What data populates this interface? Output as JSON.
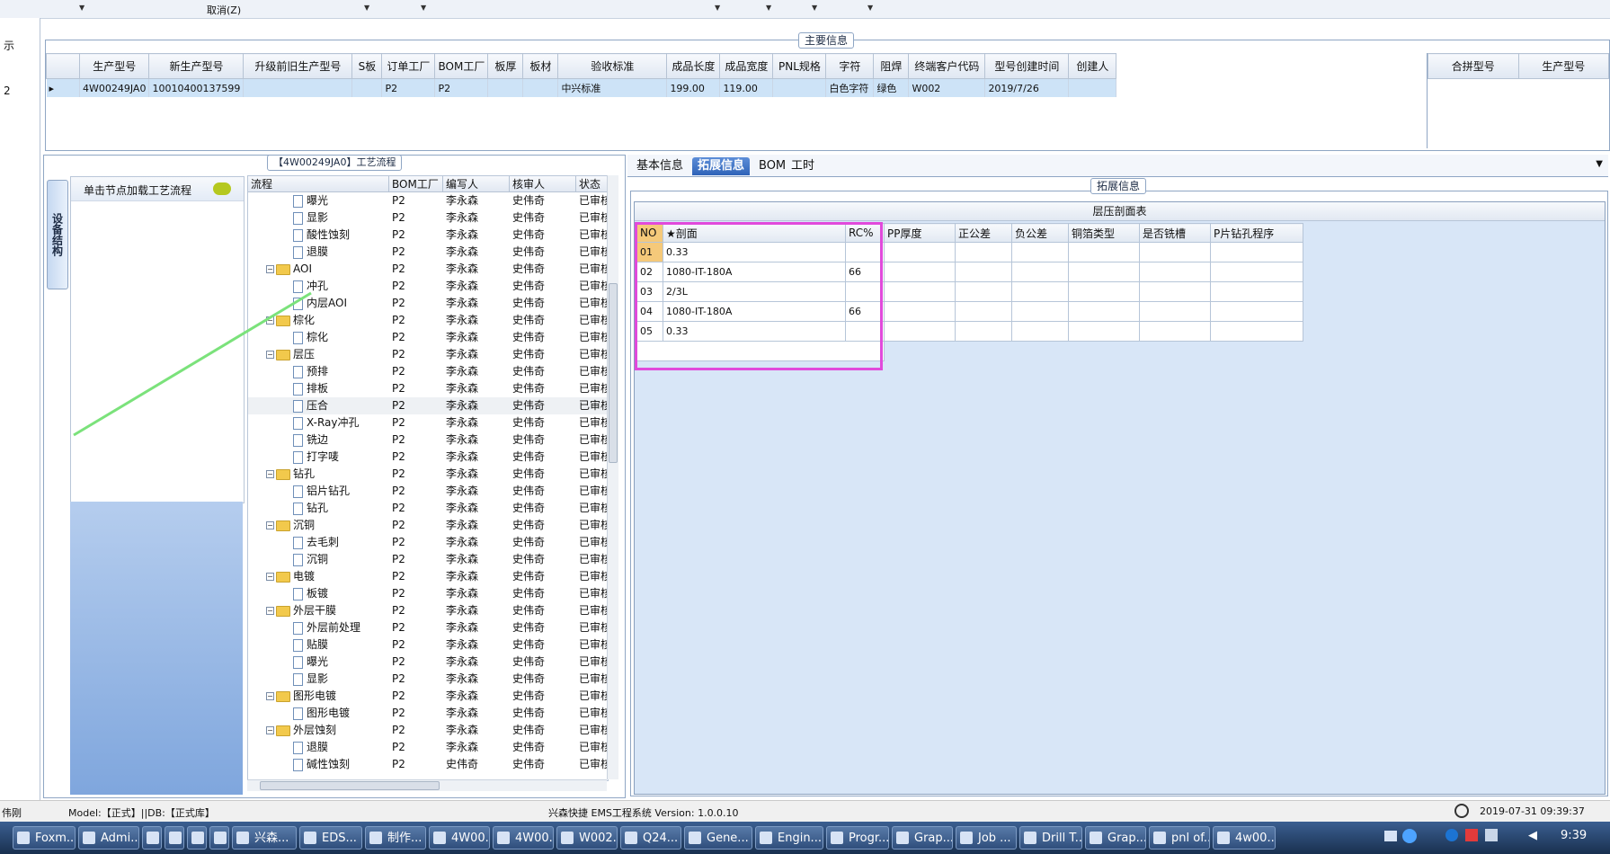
{
  "toolbar": {
    "cancel_label": "取消(Z)"
  },
  "left_strip": {
    "labels": [
      "示",
      "2",
      "伟刚"
    ]
  },
  "main_info": {
    "title": "主要信息",
    "columns": [
      "生产型号",
      "新生产型号",
      "升级前旧生产型号",
      "S板",
      "订单工厂",
      "BOM工厂",
      "板厚",
      "板材",
      "验收标准",
      "成品长度",
      "成品宽度",
      "PNL规格",
      "字符",
      "阻焊",
      "终端客户代码",
      "型号创建时间",
      "创建人"
    ],
    "row": [
      "4W00249JA0",
      "10010400137599",
      "",
      "",
      "P2",
      "P2",
      "",
      "",
      "中兴标准",
      "199.00",
      "119.00",
      "",
      "白色字符",
      "绿色",
      "W002",
      "2019/7/26",
      ""
    ],
    "right_columns": [
      "合拼型号",
      "生产型号"
    ]
  },
  "flow": {
    "title": "【4W00249JA0】工艺流程",
    "vertical_tab": "设备结构",
    "hint": "单击节点加载工艺流程",
    "headers": [
      "流程",
      "BOM工厂",
      "编写人",
      "核审人",
      "状态"
    ],
    "rows": [
      {
        "name": "曝光",
        "folder": false,
        "bom": "P2",
        "writer": "李永森",
        "reviewer": "史伟奇",
        "status": "已审核"
      },
      {
        "name": "显影",
        "folder": false,
        "bom": "P2",
        "writer": "李永森",
        "reviewer": "史伟奇",
        "status": "已审核"
      },
      {
        "name": "酸性蚀刻",
        "folder": false,
        "bom": "P2",
        "writer": "李永森",
        "reviewer": "史伟奇",
        "status": "已审核"
      },
      {
        "name": "退膜",
        "folder": false,
        "bom": "P2",
        "writer": "李永森",
        "reviewer": "史伟奇",
        "status": "已审核"
      },
      {
        "name": "AOI",
        "folder": true,
        "bom": "P2",
        "writer": "李永森",
        "reviewer": "史伟奇",
        "status": "已审核"
      },
      {
        "name": "冲孔",
        "folder": false,
        "bom": "P2",
        "writer": "李永森",
        "reviewer": "史伟奇",
        "status": "已审核"
      },
      {
        "name": "内层AOI",
        "folder": false,
        "bom": "P2",
        "writer": "李永森",
        "reviewer": "史伟奇",
        "status": "已审核"
      },
      {
        "name": "棕化",
        "folder": true,
        "bom": "P2",
        "writer": "李永森",
        "reviewer": "史伟奇",
        "status": "已审核"
      },
      {
        "name": "棕化",
        "folder": false,
        "bom": "P2",
        "writer": "李永森",
        "reviewer": "史伟奇",
        "status": "已审核"
      },
      {
        "name": "层压",
        "folder": true,
        "bom": "P2",
        "writer": "李永森",
        "reviewer": "史伟奇",
        "status": "已审核"
      },
      {
        "name": "预排",
        "folder": false,
        "bom": "P2",
        "writer": "李永森",
        "reviewer": "史伟奇",
        "status": "已审核"
      },
      {
        "name": "排板",
        "folder": false,
        "bom": "P2",
        "writer": "李永森",
        "reviewer": "史伟奇",
        "status": "已审核"
      },
      {
        "name": "压合",
        "folder": false,
        "bom": "P2",
        "writer": "李永森",
        "reviewer": "史伟奇",
        "status": "已审核"
      },
      {
        "name": "X-Ray冲孔",
        "folder": false,
        "bom": "P2",
        "writer": "李永森",
        "reviewer": "史伟奇",
        "status": "已审核"
      },
      {
        "name": "铣边",
        "folder": false,
        "bom": "P2",
        "writer": "李永森",
        "reviewer": "史伟奇",
        "status": "已审核"
      },
      {
        "name": "打字唛",
        "folder": false,
        "bom": "P2",
        "writer": "李永森",
        "reviewer": "史伟奇",
        "status": "已审核"
      },
      {
        "name": "钻孔",
        "folder": true,
        "bom": "P2",
        "writer": "李永森",
        "reviewer": "史伟奇",
        "status": "已审核"
      },
      {
        "name": "铝片钻孔",
        "folder": false,
        "bom": "P2",
        "writer": "李永森",
        "reviewer": "史伟奇",
        "status": "已审核"
      },
      {
        "name": "钻孔",
        "folder": false,
        "bom": "P2",
        "writer": "李永森",
        "reviewer": "史伟奇",
        "status": "已审核"
      },
      {
        "name": "沉铜",
        "folder": true,
        "bom": "P2",
        "writer": "李永森",
        "reviewer": "史伟奇",
        "status": "已审核"
      },
      {
        "name": "去毛刺",
        "folder": false,
        "bom": "P2",
        "writer": "李永森",
        "reviewer": "史伟奇",
        "status": "已审核"
      },
      {
        "name": "沉铜",
        "folder": false,
        "bom": "P2",
        "writer": "李永森",
        "reviewer": "史伟奇",
        "status": "已审核"
      },
      {
        "name": "电镀",
        "folder": true,
        "bom": "P2",
        "writer": "李永森",
        "reviewer": "史伟奇",
        "status": "已审核"
      },
      {
        "name": "板镀",
        "folder": false,
        "bom": "P2",
        "writer": "李永森",
        "reviewer": "史伟奇",
        "status": "已审核"
      },
      {
        "name": "外层干膜",
        "folder": true,
        "bom": "P2",
        "writer": "李永森",
        "reviewer": "史伟奇",
        "status": "已审核"
      },
      {
        "name": "外层前处理",
        "folder": false,
        "bom": "P2",
        "writer": "李永森",
        "reviewer": "史伟奇",
        "status": "已审核"
      },
      {
        "name": "贴膜",
        "folder": false,
        "bom": "P2",
        "writer": "李永森",
        "reviewer": "史伟奇",
        "status": "已审核"
      },
      {
        "name": "曝光",
        "folder": false,
        "bom": "P2",
        "writer": "李永森",
        "reviewer": "史伟奇",
        "status": "已审核"
      },
      {
        "name": "显影",
        "folder": false,
        "bom": "P2",
        "writer": "李永森",
        "reviewer": "史伟奇",
        "status": "已审核"
      },
      {
        "name": "图形电镀",
        "folder": true,
        "bom": "P2",
        "writer": "李永森",
        "reviewer": "史伟奇",
        "status": "已审核"
      },
      {
        "name": "图形电镀",
        "folder": false,
        "bom": "P2",
        "writer": "李永森",
        "reviewer": "史伟奇",
        "status": "已审核"
      },
      {
        "name": "外层蚀刻",
        "folder": true,
        "bom": "P2",
        "writer": "李永森",
        "reviewer": "史伟奇",
        "status": "已审核"
      },
      {
        "name": "退膜",
        "folder": false,
        "bom": "P2",
        "writer": "李永森",
        "reviewer": "史伟奇",
        "status": "已审核"
      },
      {
        "name": "碱性蚀刻",
        "folder": false,
        "bom": "P2",
        "writer": "史伟奇",
        "reviewer": "史伟奇",
        "status": "已审核"
      }
    ]
  },
  "right_tabs": [
    "基本信息",
    "拓展信息",
    "BOM",
    "工时"
  ],
  "ext": {
    "title": "拓展信息",
    "lam_title": "层压剖面表",
    "headers": [
      "NO",
      "★剖面",
      "RC%",
      "PP厚度",
      "正公差",
      "负公差",
      "铜箔类型",
      "是否铣槽",
      "P片钻孔程序"
    ],
    "rows": [
      [
        "01",
        "0.33",
        "",
        "",
        "",
        "",
        "",
        "",
        ""
      ],
      [
        "02",
        "1080-IT-180A",
        "66",
        "",
        "",
        "",
        "",
        "",
        ""
      ],
      [
        "03",
        "2/3L",
        "",
        "",
        "",
        "",
        "",
        "",
        ""
      ],
      [
        "04",
        "1080-IT-180A",
        "66",
        "",
        "",
        "",
        "",
        "",
        ""
      ],
      [
        "05",
        "0.33",
        "",
        "",
        "",
        "",
        "",
        "",
        ""
      ]
    ]
  },
  "status": {
    "model": "Model:【正式】||DB:【正式库】",
    "app": "兴森快捷 EMS工程系统 Version: 1.0.0.10",
    "datetime": "2019-07-31 09:39:37"
  },
  "taskbar": {
    "items": [
      "Foxm...",
      "Admi...",
      "",
      "",
      "",
      "",
      "兴森...",
      "EDS...",
      "制作...",
      "4W00...",
      "4W00...",
      "W002...",
      "Q24...",
      "Gene...",
      "Engin...",
      "Progr...",
      "Grap...",
      "Job ...",
      "Drill T...",
      "Grap...",
      "pnl of...",
      "4w00..."
    ],
    "clock": "9:39"
  }
}
